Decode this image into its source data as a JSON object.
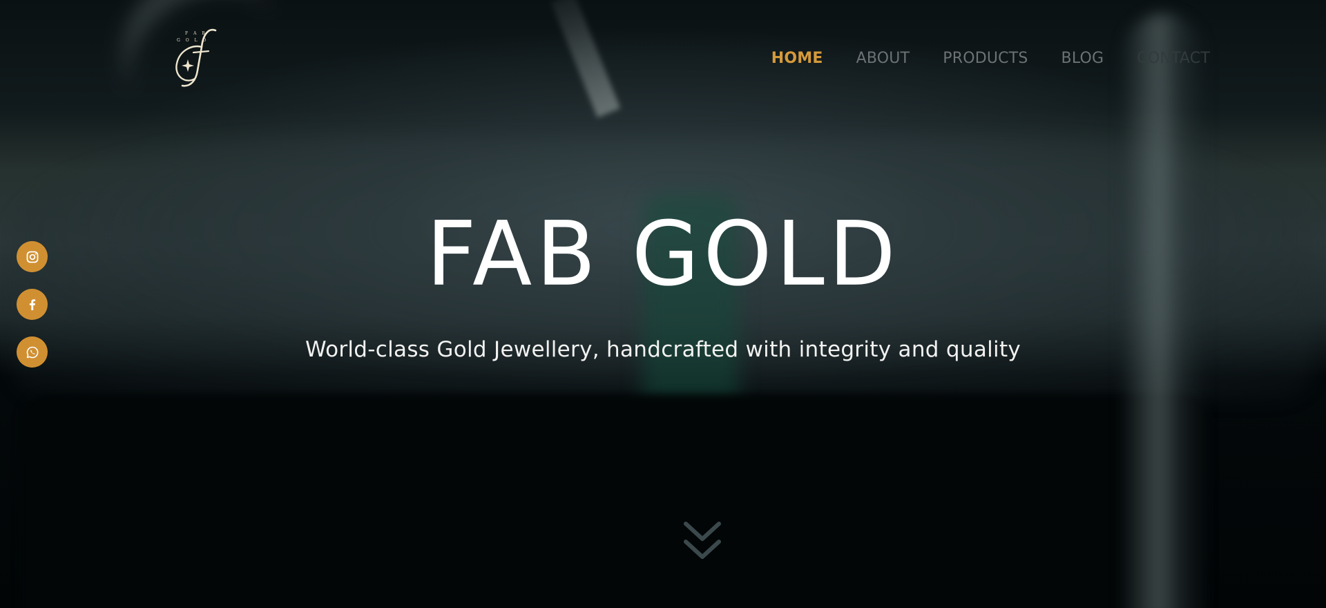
{
  "brand": {
    "logo_wordmark": "FAB GOLD",
    "logo_icon": "fab-gold-monogram-f-with-star"
  },
  "nav": {
    "items": [
      {
        "label": "HOME",
        "active": true
      },
      {
        "label": "ABOUT",
        "active": false
      },
      {
        "label": "PRODUCTS",
        "active": false
      },
      {
        "label": "BLOG",
        "active": false
      },
      {
        "label": "CONTACT",
        "active": false
      }
    ]
  },
  "hero": {
    "title": "FAB GOLD",
    "subtitle": "World-class Gold Jewellery, handcrafted with integrity and quality"
  },
  "social": [
    {
      "icon": "instagram-icon"
    },
    {
      "icon": "facebook-icon"
    },
    {
      "icon": "whatsapp-icon"
    }
  ],
  "scroll": {
    "icon": "double-chevron-down-icon"
  },
  "colors": {
    "accent": "#d59a3b",
    "social_button": "#d09032",
    "nav_inactive": "#6d7375",
    "background": "#05090b",
    "text": "#ffffff"
  }
}
